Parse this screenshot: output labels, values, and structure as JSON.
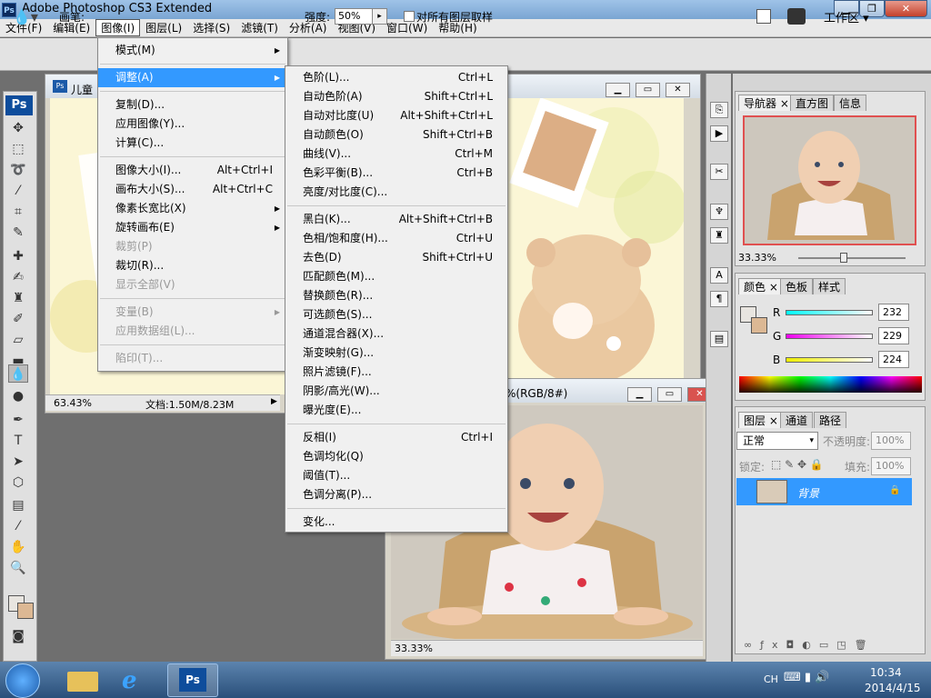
{
  "window": {
    "title": "Adobe Photoshop CS3 Extended",
    "app_icon": "Ps"
  },
  "menubar": [
    "文件(F)",
    "编辑(E)",
    "图像(I)",
    "图层(L)",
    "选择(S)",
    "滤镜(T)",
    "分析(A)",
    "视图(V)",
    "窗口(W)",
    "帮助(H)"
  ],
  "options": {
    "pen_label": "画笔:",
    "strength_label": "强度:",
    "strength_value": "50%",
    "sample_all": "对所有图层取样",
    "workspace": "工作区 ▾"
  },
  "doc1": {
    "name": "儿童",
    "zoom": "63.43%",
    "doc_info": "文档:1.50M/8.23M"
  },
  "doc2": {
    "name": "%(RGB/8#)",
    "zoom": "33.33%"
  },
  "image_menu": [
    {
      "label": "模式(M)",
      "submenu": true
    },
    {
      "sep": true
    },
    {
      "label": "调整(A)",
      "submenu": true,
      "hl": true
    },
    {
      "sep": true
    },
    {
      "label": "复制(D)..."
    },
    {
      "label": "应用图像(Y)..."
    },
    {
      "label": "计算(C)..."
    },
    {
      "sep": true
    },
    {
      "label": "图像大小(I)...",
      "shortcut": "Alt+Ctrl+I"
    },
    {
      "label": "画布大小(S)...",
      "shortcut": "Alt+Ctrl+C"
    },
    {
      "label": "像素长宽比(X)",
      "submenu": true
    },
    {
      "label": "旋转画布(E)",
      "submenu": true
    },
    {
      "label": "裁剪(P)",
      "disabled": true
    },
    {
      "label": "裁切(R)..."
    },
    {
      "label": "显示全部(V)",
      "disabled": true
    },
    {
      "sep": true
    },
    {
      "label": "变量(B)",
      "submenu": true,
      "disabled": true
    },
    {
      "label": "应用数据组(L)...",
      "disabled": true
    },
    {
      "sep": true
    },
    {
      "label": "陷印(T)...",
      "disabled": true
    }
  ],
  "adjust_menu": [
    {
      "label": "色阶(L)...",
      "shortcut": "Ctrl+L"
    },
    {
      "label": "自动色阶(A)",
      "shortcut": "Shift+Ctrl+L"
    },
    {
      "label": "自动对比度(U)",
      "shortcut": "Alt+Shift+Ctrl+L"
    },
    {
      "label": "自动颜色(O)",
      "shortcut": "Shift+Ctrl+B"
    },
    {
      "label": "曲线(V)...",
      "shortcut": "Ctrl+M"
    },
    {
      "label": "色彩平衡(B)...",
      "shortcut": "Ctrl+B"
    },
    {
      "label": "亮度/对比度(C)..."
    },
    {
      "sep": true
    },
    {
      "label": "黑白(K)...",
      "shortcut": "Alt+Shift+Ctrl+B"
    },
    {
      "label": "色相/饱和度(H)...",
      "shortcut": "Ctrl+U"
    },
    {
      "label": "去色(D)",
      "shortcut": "Shift+Ctrl+U"
    },
    {
      "label": "匹配颜色(M)..."
    },
    {
      "label": "替换颜色(R)..."
    },
    {
      "label": "可选颜色(S)..."
    },
    {
      "label": "通道混合器(X)..."
    },
    {
      "label": "渐变映射(G)..."
    },
    {
      "label": "照片滤镜(F)..."
    },
    {
      "label": "阴影/高光(W)..."
    },
    {
      "label": "曝光度(E)..."
    },
    {
      "sep": true
    },
    {
      "label": "反相(I)",
      "shortcut": "Ctrl+I"
    },
    {
      "label": "色调均化(Q)"
    },
    {
      "label": "阈值(T)..."
    },
    {
      "label": "色调分离(P)..."
    },
    {
      "sep": true
    },
    {
      "label": "变化..."
    }
  ],
  "navigator": {
    "tabs": [
      "导航器",
      "直方图",
      "信息"
    ],
    "zoom": "33.33%"
  },
  "color": {
    "tabs": [
      "颜色",
      "色板",
      "样式"
    ],
    "r_label": "R",
    "g_label": "G",
    "b_label": "B",
    "r": "232",
    "g": "229",
    "b": "224"
  },
  "layers": {
    "tabs": [
      "图层",
      "通道",
      "路径"
    ],
    "blend": "正常",
    "opacity_label": "不透明度:",
    "opacity": "100%",
    "lock_label": "锁定:",
    "fill_label": "填充:",
    "fill": "100%",
    "layer_name": "背景"
  },
  "taskbar": {
    "lang": "CH",
    "time": "10:34",
    "date": "2014/4/15"
  }
}
